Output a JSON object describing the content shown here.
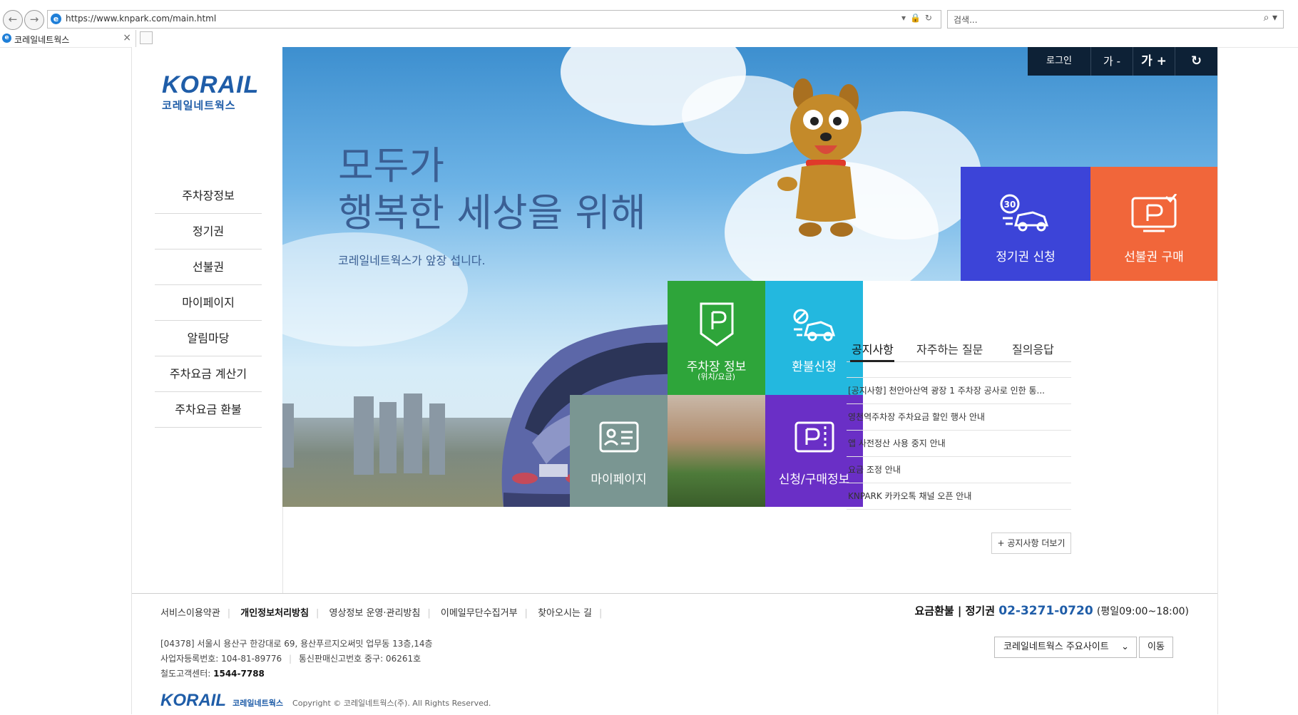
{
  "browser": {
    "url": "https://www.knpark.com/main.html",
    "search_placeholder": "검색...",
    "tab_title": "코레일네트웍스"
  },
  "logo": {
    "word": "KORAIL",
    "sub": "코레일네트웍스"
  },
  "menu": [
    "주차장정보",
    "정기권",
    "선불권",
    "마이페이지",
    "알림마당",
    "주차요금 계산기",
    "주차요금 환불"
  ],
  "hero": {
    "line1": "모두가",
    "line2": "행복한 세상을 위해",
    "sub": "코레일네트웍스가 앞장 섭니다."
  },
  "topbar": {
    "login": "로그인",
    "font_down": "가 -",
    "font_up": "가 +",
    "refresh_icon": "refresh-icon"
  },
  "tiles": {
    "season_apply": {
      "label": "정기권 신청",
      "color": "#3c44d8",
      "badge": "30"
    },
    "prepaid_buy": {
      "label": "선불권 구매",
      "color": "#f1663a"
    },
    "parking_info": {
      "label": "주차장 정보",
      "sub": "(위치/요금)",
      "color": "#2ea53a"
    },
    "refund": {
      "label": "환불신청",
      "color": "#23b8df"
    },
    "mypage": {
      "label": "마이페이지",
      "color": "#7a9692"
    },
    "purchase_info": {
      "label": "신청/구매정보",
      "color": "#6a2fc6"
    }
  },
  "notices": {
    "tabs": [
      "공지사항",
      "자주하는 질문",
      "질의응답"
    ],
    "items": [
      "[공지사항] 천안아산역 광장 1 주차장 공사로 인한 통...",
      "영천역주차장 주차요금 할인 행사 안내",
      "앱 사전정산 사용 중지 안내",
      "요금 조정 안내",
      "KNPARK 카카오톡 채널 오픈 안내"
    ],
    "more": "+ 공지사항 더보기"
  },
  "footer": {
    "links": [
      "서비스이용약관",
      "개인정보처리방침",
      "영상정보 운영·관리방침",
      "이메일무단수집거부",
      "찾아오시는 길"
    ],
    "help_label": "요금환불 | 정기권",
    "phone": "02-3271-0720",
    "hours": "(평일09:00~18:00)",
    "address": "[04378] 서울시 용산구 한강대로 69, 용산푸르지오써밋 업무동 13층,14층",
    "biz_no": "사업자등록번호: 104-81-89776",
    "mail_order": "통신판매신고번호 중구: 06261호",
    "cs_label": "철도고객센터:",
    "cs_phone": "1544-7788",
    "logo_word": "KORAIL",
    "logo_small": "코레일네트웍스",
    "copyright": "Copyright © 코레일네트웍스(주). All Rights Reserved.",
    "select_value": "코레일네트웍스 주요사이트",
    "go_button": "이동"
  }
}
